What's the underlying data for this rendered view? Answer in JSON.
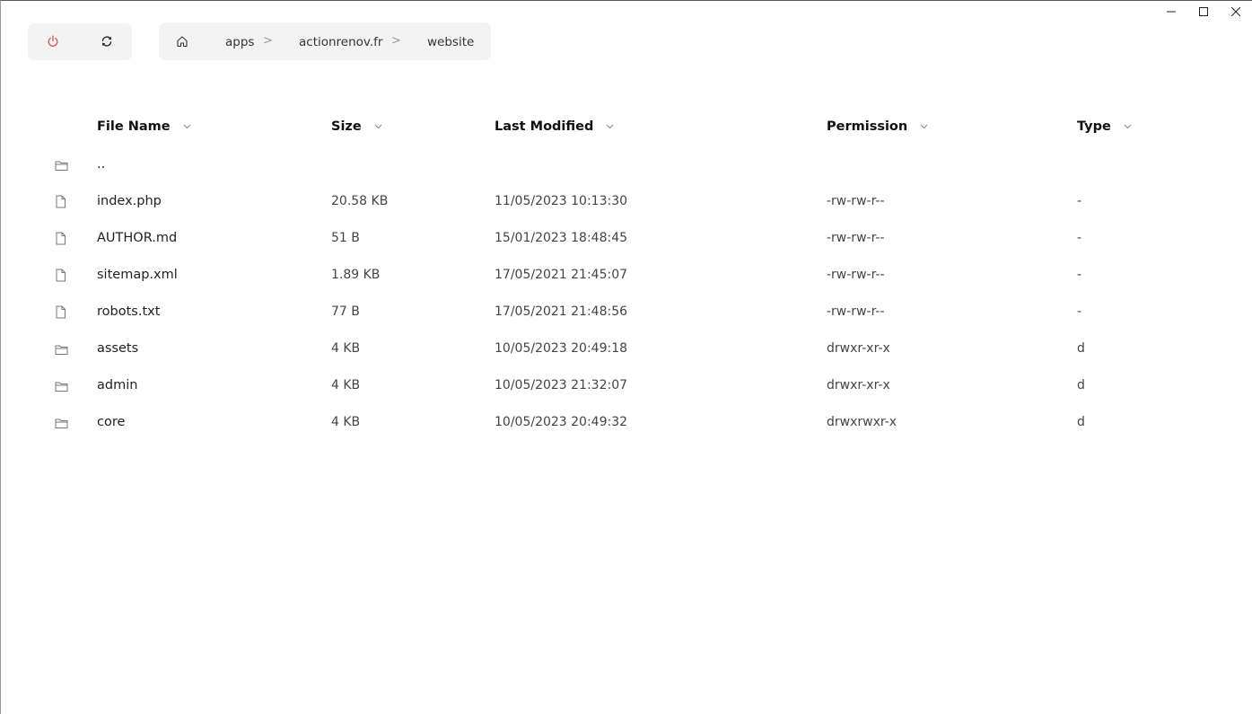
{
  "window": {
    "controls": [
      {
        "name": "minimize",
        "icon": "minimize-icon"
      },
      {
        "name": "maximize",
        "icon": "maximize-icon"
      },
      {
        "name": "close",
        "icon": "close-icon"
      }
    ]
  },
  "toolbar": {
    "power_icon": "power-icon",
    "refresh_icon": "refresh-icon",
    "power_color": "#d9534f"
  },
  "breadcrumb": {
    "home_icon": "home-icon",
    "items": [
      "apps",
      "actionrenov.fr",
      "website"
    ],
    "separator": ">"
  },
  "table": {
    "columns": [
      "File Name",
      "Size",
      "Last Modified",
      "Permission",
      "Type"
    ],
    "rows": [
      {
        "icon": "folder-icon",
        "name": "..",
        "size": "",
        "modified": "",
        "permission": "",
        "type": ""
      },
      {
        "icon": "file-icon",
        "name": "index.php",
        "size": "20.58 KB",
        "modified": "11/05/2023 10:13:30",
        "permission": "-rw-rw-r--",
        "type": "-"
      },
      {
        "icon": "file-icon",
        "name": "AUTHOR.md",
        "size": "51 B",
        "modified": "15/01/2023 18:48:45",
        "permission": "-rw-rw-r--",
        "type": "-"
      },
      {
        "icon": "file-icon",
        "name": "sitemap.xml",
        "size": "1.89 KB",
        "modified": "17/05/2021 21:45:07",
        "permission": "-rw-rw-r--",
        "type": "-"
      },
      {
        "icon": "file-icon",
        "name": "robots.txt",
        "size": "77 B",
        "modified": "17/05/2021 21:48:56",
        "permission": "-rw-rw-r--",
        "type": "-"
      },
      {
        "icon": "folder-icon",
        "name": "assets",
        "size": "4 KB",
        "modified": "10/05/2023 20:49:18",
        "permission": "drwxr-xr-x",
        "type": "d"
      },
      {
        "icon": "folder-icon",
        "name": "admin",
        "size": "4 KB",
        "modified": "10/05/2023 21:32:07",
        "permission": "drwxr-xr-x",
        "type": "d"
      },
      {
        "icon": "folder-icon",
        "name": "core",
        "size": "4 KB",
        "modified": "10/05/2023 20:49:32",
        "permission": "drwxrwxr-x",
        "type": "d"
      }
    ]
  }
}
